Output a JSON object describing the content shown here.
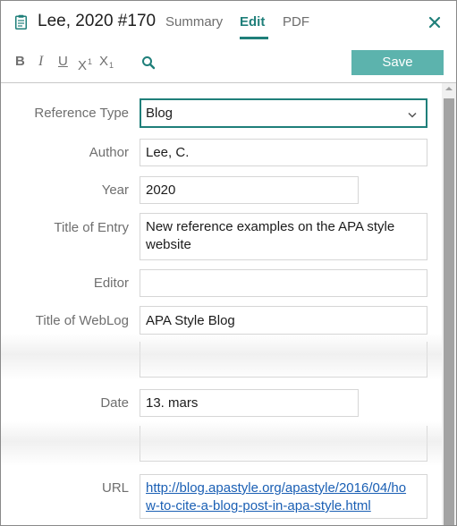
{
  "header": {
    "title": "Lee, 2020 #170",
    "tabs": {
      "summary": "Summary",
      "edit": "Edit",
      "pdf": "PDF"
    }
  },
  "toolbar": {
    "bold": "B",
    "italic": "I",
    "underline": "U",
    "superscript": "X",
    "superscript_mark": "1",
    "subscript": "X",
    "subscript_mark": "1",
    "save_label": "Save"
  },
  "form": {
    "reference_type": {
      "label": "Reference Type",
      "value": "Blog"
    },
    "author": {
      "label": "Author",
      "value": "Lee, C."
    },
    "year": {
      "label": "Year",
      "value": "2020"
    },
    "title_of_entry": {
      "label": "Title of Entry",
      "line1": "New reference examples on the APA style",
      "line2": "website"
    },
    "editor": {
      "label": "Editor",
      "value": ""
    },
    "title_of_weblog": {
      "label": "Title of WebLog",
      "value": "APA Style Blog"
    },
    "date": {
      "label": "Date",
      "value": "13. mars"
    },
    "url": {
      "label": "URL",
      "line1": "http://blog.apastyle.org/apastyle/2016/04/ho",
      "line2": "w-to-cite-a-blog-post-in-apa-style.html"
    }
  },
  "icons": {
    "document": "clipboard-icon",
    "close": "close-icon",
    "search": "search-icon",
    "dropdown": "chevron-down-icon"
  },
  "colors": {
    "accent": "#1f7f7a",
    "save_button": "#5cb3ad",
    "link": "#1a5fb4"
  }
}
